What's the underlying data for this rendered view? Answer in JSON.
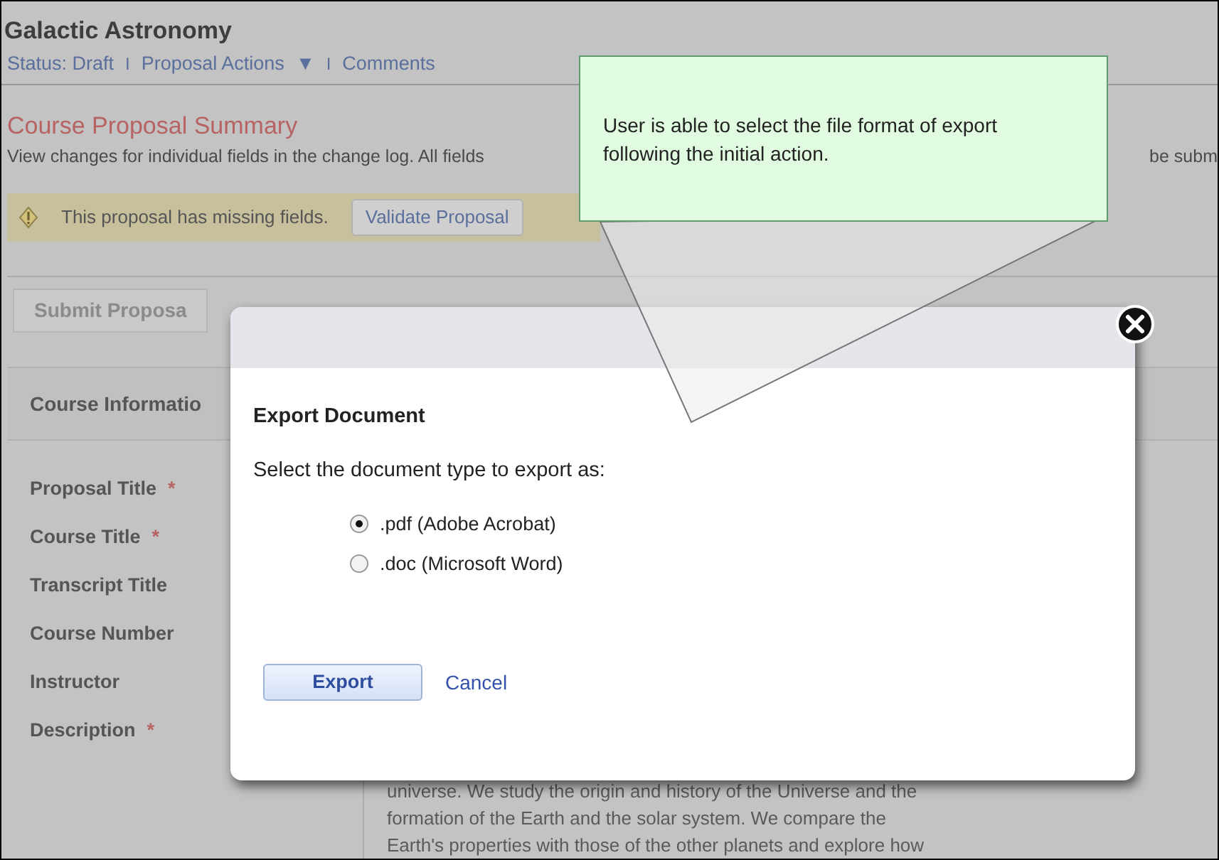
{
  "page": {
    "title": "Galactic Astronomy",
    "links": [
      {
        "label": "Status: Draft"
      },
      {
        "label": "Proposal Actions",
        "dropdown": "▼"
      },
      {
        "label": "Comments"
      }
    ],
    "separators": [
      "I",
      "I"
    ],
    "summary": {
      "title": "Course Proposal Summary",
      "text": "View changes for individual fields in the change log. All fields",
      "text_right": "be subm"
    },
    "warning": {
      "text": "This proposal has missing fields.",
      "button": "Validate Proposal"
    },
    "submit_button": "Submit Proposa",
    "section_title": "Course Informatio",
    "fields": [
      {
        "label": "Proposal Title",
        "marker": "*"
      },
      {
        "label": "Course Title",
        "marker": "*"
      },
      {
        "label": "Transcript Title"
      },
      {
        "label": "Course Number"
      },
      {
        "label": "Instructor"
      },
      {
        "label": "Description",
        "marker": "*"
      }
    ],
    "description_lines": [
      "universe. We study the origin and history of the Universe and the",
      "formation of the Earth and the solar system. We compare the",
      "Earth's properties with those of the other planets and explore how"
    ]
  },
  "dialog": {
    "title": "Export Document",
    "prompt": "Select the document type to export as:",
    "options": [
      {
        "label": ".pdf (Adobe Acrobat)",
        "selected": true
      },
      {
        "label": ".doc (Microsoft Word)",
        "selected": false
      }
    ],
    "primary_button": "Export",
    "cancel_link": "Cancel"
  },
  "callout": {
    "text": "User is able to select the file format of export following the initial action."
  }
}
